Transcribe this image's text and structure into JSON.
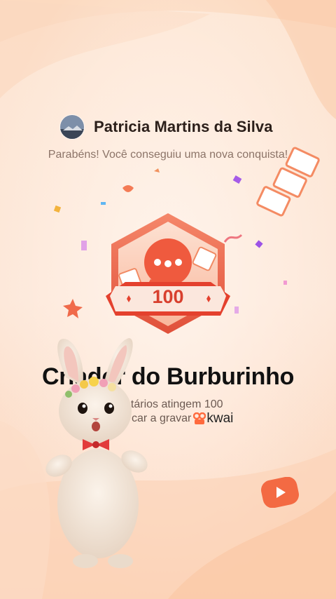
{
  "user": {
    "name": "Patricia Martins da Silva"
  },
  "achievement": {
    "message": "Parabéns! Você conseguiu uma nova conquista!",
    "badge_count": "100",
    "title": "Criador do Burburinho",
    "description_line1": "ntários atingem 100",
    "description_line2": "car a gravar"
  },
  "brand": {
    "logo_text": "kwai",
    "logo_icon": "kwai-logo-icon",
    "accent": "#ff6a3d"
  },
  "colors": {
    "background_top": "#fde3cf",
    "background_bottom": "#fbd6bd",
    "badge_red": "#e8503a",
    "badge_light": "#ffd7c8"
  },
  "icons": {
    "avatar": "avatar-image",
    "badge": "chat-bubble-badge-icon",
    "play": "play-icon",
    "mascot": "bunny-mascot"
  }
}
